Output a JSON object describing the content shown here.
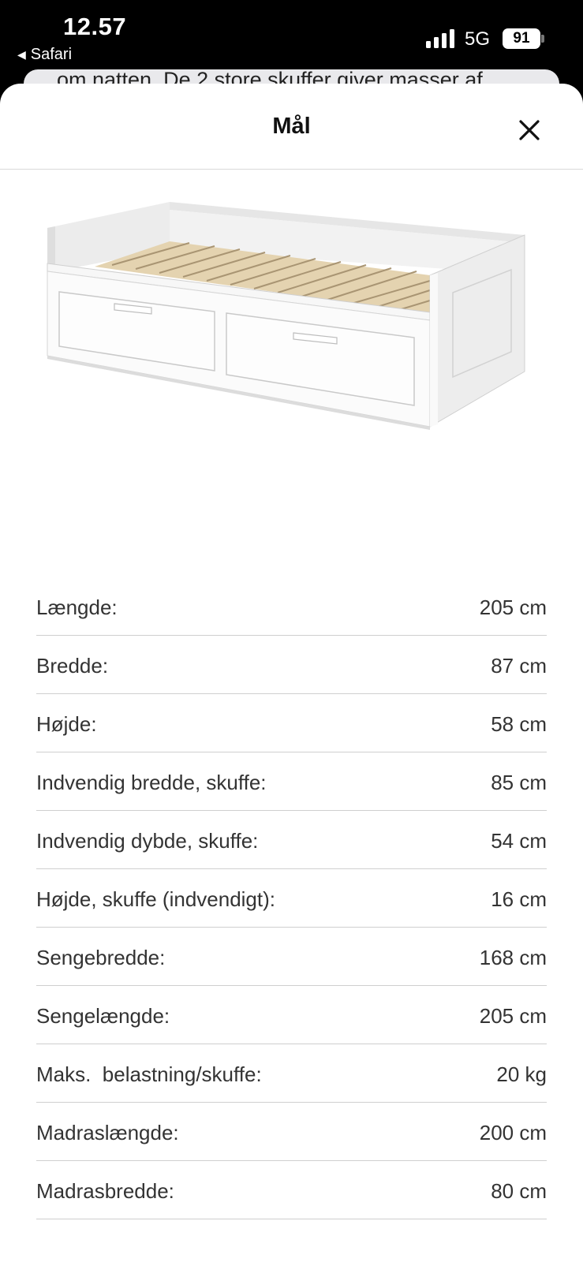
{
  "status_bar": {
    "time": "12.57",
    "back_app": "Safari",
    "network": "5G",
    "battery": "91",
    "icons": [
      "signal-icon",
      "battery-icon",
      "back-arrow-icon"
    ]
  },
  "background_page": {
    "partial_text": "om natten. De 2 store skuffer giver masser af"
  },
  "sheet": {
    "title": "Mål",
    "close_icon": "close-icon"
  },
  "dimensions": [
    {
      "label": "Længde:",
      "value": "205 cm"
    },
    {
      "label": "Bredde:",
      "value": "87 cm"
    },
    {
      "label": "Højde:",
      "value": "58 cm"
    },
    {
      "label": "Indvendig bredde, skuffe:",
      "value": "85 cm"
    },
    {
      "label": "Indvendig dybde, skuffe:",
      "value": "54 cm"
    },
    {
      "label": "Højde, skuffe (indvendigt):",
      "value": "16 cm"
    },
    {
      "label": "Sengebredde:",
      "value": "168 cm"
    },
    {
      "label": "Sengelængde:",
      "value": "205 cm"
    },
    {
      "label": "Maks.  belastning/skuffe:",
      "value": "20 kg"
    },
    {
      "label": "Madraslængde:",
      "value": "200 cm"
    },
    {
      "label": "Madrasbredde:",
      "value": "80 cm"
    }
  ]
}
